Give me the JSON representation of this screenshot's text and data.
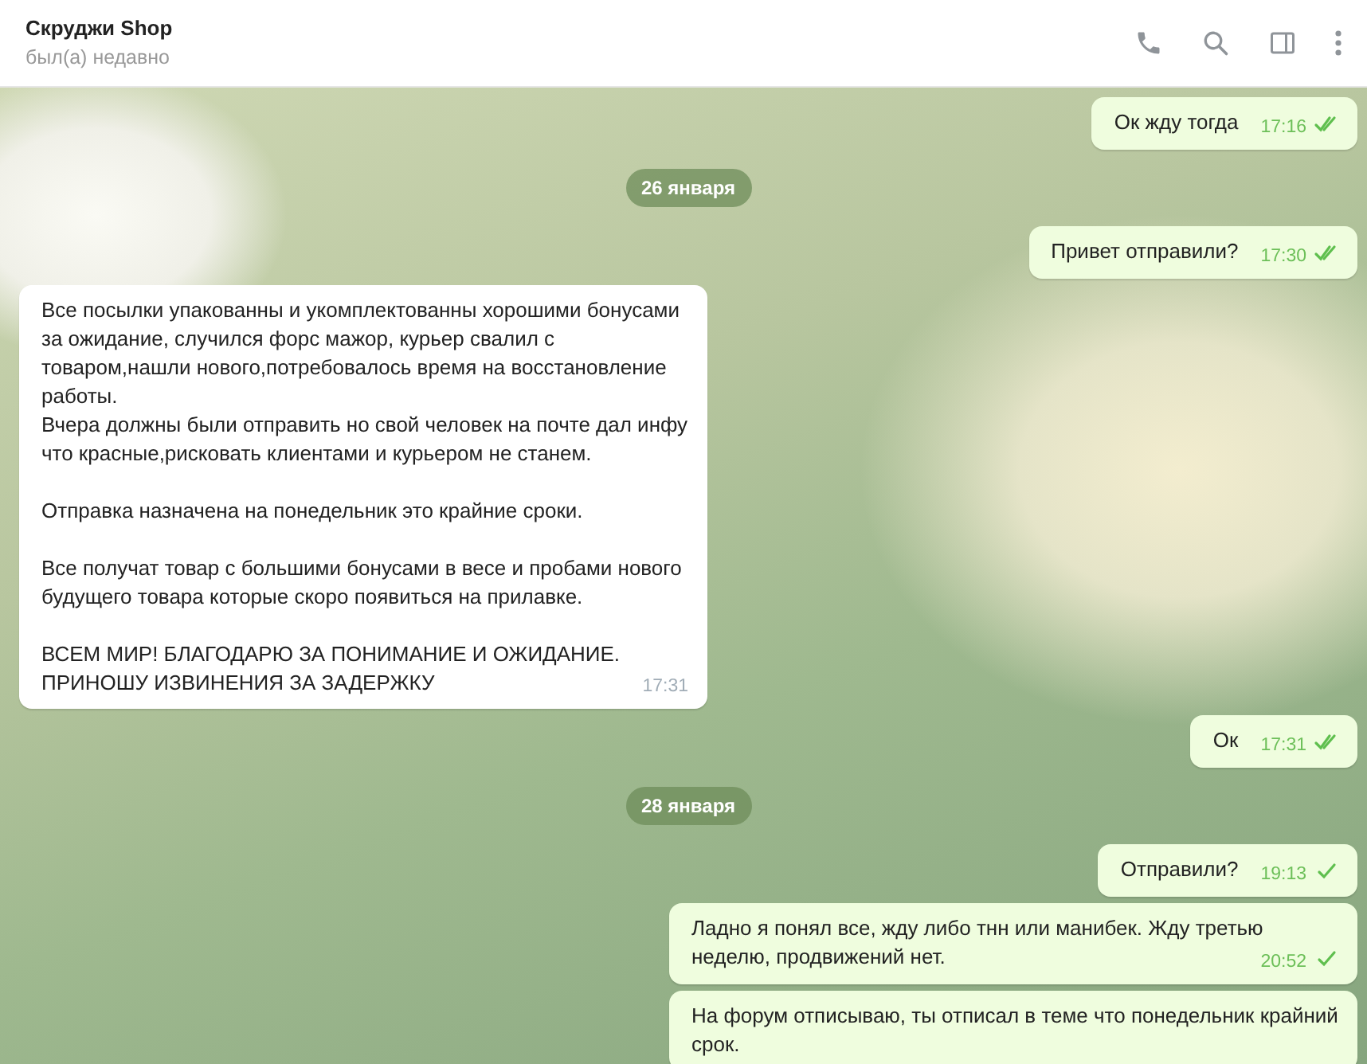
{
  "header": {
    "title": "Скруджи Shop",
    "status": "был(а) недавно"
  },
  "messages": [
    {
      "kind": "message",
      "outgoing": true,
      "text": "Ок жду тогда",
      "time": "17:16",
      "read": true
    },
    {
      "kind": "date",
      "text": "26 января"
    },
    {
      "kind": "message",
      "outgoing": true,
      "text": "Привет отправили?",
      "time": "17:30",
      "read": true
    },
    {
      "kind": "message",
      "outgoing": false,
      "text": "Все посылки упакованны и укомплектованны хорошими бонусами за ожидание, случился форс мажор, курьер свалил с товаром,нашли нового,потребовалось время на восстановление работы.\nВчера должны были отправить но свой человек на почте дал инфу что красные,рисковать клиентами и курьером не станем.\n\nОтправка назначена на понедельник это крайние сроки.\n\nВсе получат товар с большими бонусами в весе и пробами нового будущего товара которые скоро появиться на прилавке.\n\nВСЕМ МИР! БЛАГОДАРЮ ЗА ПОНИМАНИЕ И ОЖИДАНИЕ.\nПРИНОШУ ИЗВИНЕНИЯ ЗА ЗАДЕРЖКУ",
      "time": "17:31"
    },
    {
      "kind": "message",
      "outgoing": true,
      "text": "Ок",
      "time": "17:31",
      "read": true
    },
    {
      "kind": "date",
      "text": "28 января"
    },
    {
      "kind": "message",
      "outgoing": true,
      "text": "Отправили?",
      "time": "19:13",
      "read": false
    },
    {
      "kind": "message",
      "outgoing": true,
      "text": "Ладно я понял все, жду либо тнн или манибек. Жду третью неделю, продвижений нет.",
      "time": "20:52",
      "read": false
    },
    {
      "kind": "message",
      "outgoing": true,
      "text": "На форум отписываю, ты отписал в теме что понедельник крайний срок."
    }
  ]
}
